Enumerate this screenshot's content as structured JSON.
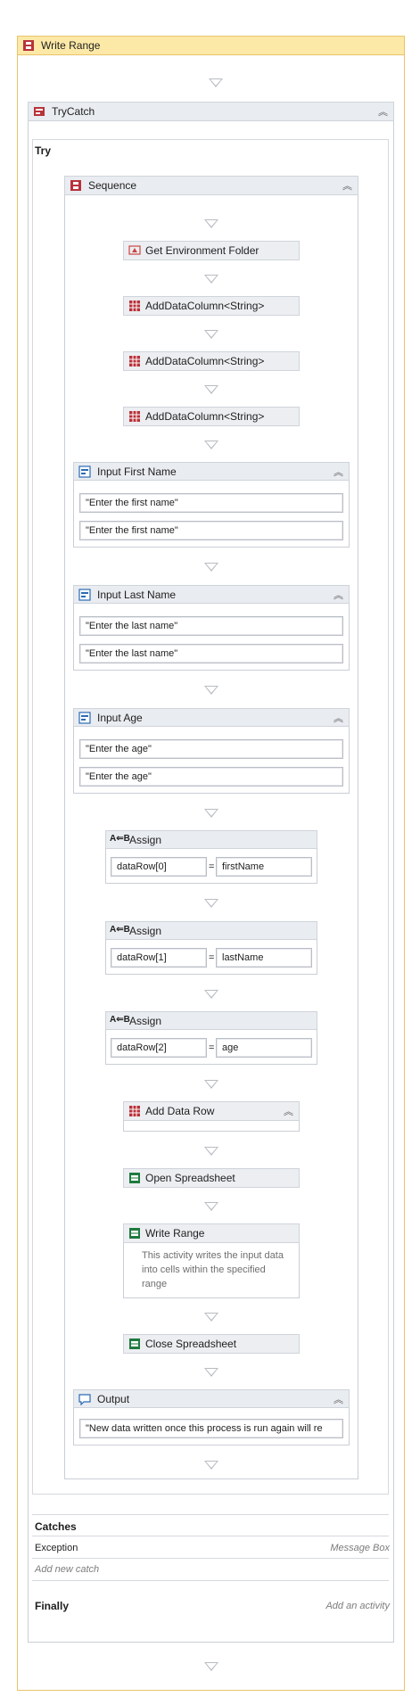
{
  "outer": {
    "title": "Write Range"
  },
  "trycatch": {
    "title": "TryCatch",
    "try_label": "Try",
    "catches_label": "Catches",
    "exception_label": "Exception",
    "exception_handler": "Message Box",
    "add_catch": "Add new catch",
    "finally_label": "Finally",
    "finally_hint": "Add an activity"
  },
  "sequence": {
    "title": "Sequence"
  },
  "activities": {
    "get_env": "Get Environment Folder",
    "add_col1": "AddDataColumn<String>",
    "add_col2": "AddDataColumn<String>",
    "add_col3": "AddDataColumn<String>",
    "add_row": "Add Data Row",
    "open_ss": "Open Spreadsheet",
    "write_range": "Write Range",
    "write_range_desc": "This activity writes the input data into cells within the specified range",
    "close_ss": "Close Spreadsheet"
  },
  "inputs": {
    "first": {
      "title": "Input First Name",
      "v1": "\"Enter the first name\"",
      "v2": "\"Enter the first name\""
    },
    "last": {
      "title": "Input Last Name",
      "v1": "\"Enter the last name\"",
      "v2": "\"Enter the last name\""
    },
    "age": {
      "title": "Input Age",
      "v1": "\"Enter the age\"",
      "v2": "\"Enter the age\""
    }
  },
  "assigns": [
    {
      "title": "Assign",
      "to": "dataRow[0]",
      "value": "firstName"
    },
    {
      "title": "Assign",
      "to": "dataRow[1]",
      "value": "lastName"
    },
    {
      "title": "Assign",
      "to": "dataRow[2]",
      "value": "age"
    }
  ],
  "assign_eq": "=",
  "output": {
    "title": "Output",
    "value": "\"New data written once this process is run again will re"
  },
  "icons": {
    "sequence": "sequence-icon",
    "trycatch": "trycatch-icon",
    "datatable": "datatable-icon",
    "excel": "excel-icon",
    "input": "input-dialog-icon",
    "assign": "assign-icon",
    "message": "message-icon",
    "environment": "environment-icon"
  },
  "colors": {
    "accent_yellow": "#fde9a7",
    "border_yellow": "#e8c46a",
    "excel_green": "#1f7a3f",
    "datatable_red": "#b8323a"
  }
}
